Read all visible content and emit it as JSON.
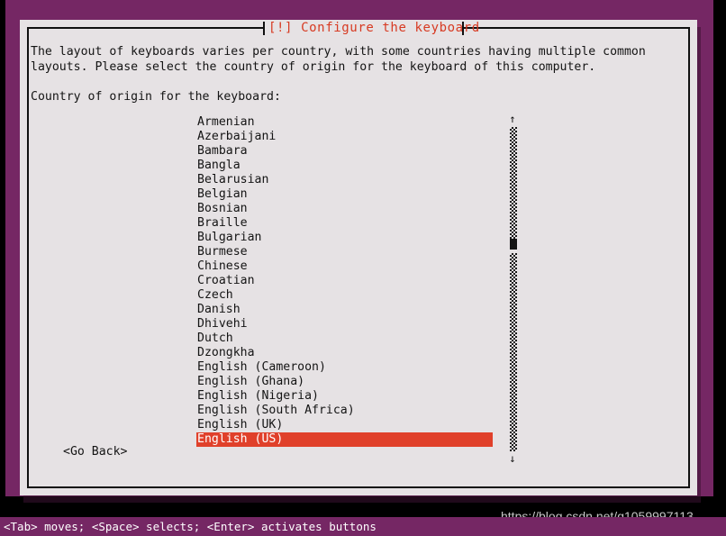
{
  "window": {
    "title": "[!] Configure the keyboard"
  },
  "content": {
    "intro": "The layout of keyboards varies per country, with some countries having multiple common\nlayouts. Please select the country of origin for the keyboard of this computer.",
    "prompt": "Country of origin for the keyboard:"
  },
  "list": {
    "selected_index": 23,
    "items": [
      {
        "label": "Armenian",
        "selected": false
      },
      {
        "label": "Azerbaijani",
        "selected": false
      },
      {
        "label": "Bambara",
        "selected": false
      },
      {
        "label": "Bangla",
        "selected": false
      },
      {
        "label": "Belarusian",
        "selected": false
      },
      {
        "label": "Belgian",
        "selected": false
      },
      {
        "label": "Bosnian",
        "selected": false
      },
      {
        "label": "Braille",
        "selected": false
      },
      {
        "label": "Bulgarian",
        "selected": false
      },
      {
        "label": "Burmese",
        "selected": false
      },
      {
        "label": "Chinese",
        "selected": false
      },
      {
        "label": "Croatian",
        "selected": false
      },
      {
        "label": "Czech",
        "selected": false
      },
      {
        "label": "Danish",
        "selected": false
      },
      {
        "label": "Dhivehi",
        "selected": false
      },
      {
        "label": "Dutch",
        "selected": false
      },
      {
        "label": "Dzongkha",
        "selected": false
      },
      {
        "label": "English (Cameroon)",
        "selected": false
      },
      {
        "label": "English (Ghana)",
        "selected": false
      },
      {
        "label": "English (Nigeria)",
        "selected": false
      },
      {
        "label": "English (South Africa)",
        "selected": false
      },
      {
        "label": "English (UK)",
        "selected": false
      },
      {
        "label": "English (US)",
        "selected": true
      }
    ]
  },
  "scrollbar": {
    "up_arrow": "↑",
    "down_arrow": "↓"
  },
  "buttons": {
    "go_back": "<Go Back>"
  },
  "statusbar": {
    "text": "<Tab> moves; <Space> selects; <Enter> activates buttons"
  },
  "watermark": {
    "text": "https://blog.csdn.net/q1059997113"
  },
  "colors": {
    "backdrop_purple": "#752764",
    "dialog_background": "#e6e2e4",
    "title_red": "#d73a22",
    "highlight_orange": "#e0402a",
    "text_black": "#141414",
    "statusbar_text": "#ffffff"
  }
}
